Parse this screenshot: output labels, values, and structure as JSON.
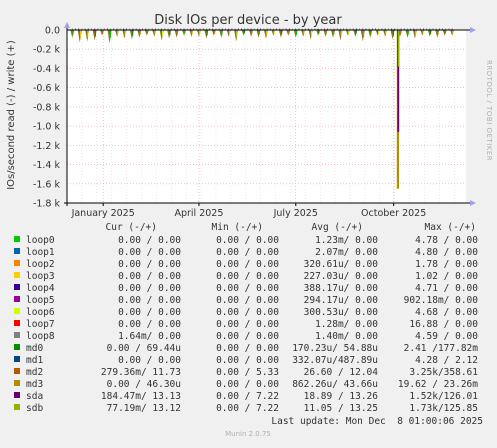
{
  "chart_data": {
    "type": "line",
    "title": "Disk IOs per device - by year",
    "ylabel": "IOs/second read (-) / write (+)",
    "side_label": "RRDTOOL / TOBI OETIKER",
    "ylim": [
      -1800,
      0
    ],
    "yticks": [
      {
        "v": 0,
        "label": "0.0"
      },
      {
        "v": -200,
        "label": "-0.2 k"
      },
      {
        "v": -400,
        "label": "-0.4 k"
      },
      {
        "v": -600,
        "label": "-0.6 k"
      },
      {
        "v": -800,
        "label": "-0.8 k"
      },
      {
        "v": -1000,
        "label": "-1.0 k"
      },
      {
        "v": -1200,
        "label": "-1.2 k"
      },
      {
        "v": -1400,
        "label": "-1.4 k"
      },
      {
        "v": -1600,
        "label": "-1.6 k"
      },
      {
        "v": -1800,
        "label": "-1.8 k"
      }
    ],
    "x_range": [
      "2024-11-28",
      "2025-12-08"
    ],
    "xticks": [
      {
        "date": "2025-01-01",
        "label": "January 2025"
      },
      {
        "date": "2025-04-01",
        "label": "April 2025"
      },
      {
        "date": "2025-07-01",
        "label": "July 2025"
      },
      {
        "date": "2025-10-01",
        "label": "October 2025"
      }
    ],
    "grid": true,
    "spike_start": "2024-12-03",
    "spike_period_days": 7,
    "spike_values": [
      -80,
      -130,
      -120,
      -110,
      -60,
      -140,
      -70,
      -90,
      -100,
      -80,
      -60,
      -70,
      -110,
      -90,
      -80,
      -60,
      -70,
      -70,
      -90,
      -60,
      -80,
      -70,
      -120,
      -60,
      -70,
      -80,
      -90,
      -60,
      -80,
      -60,
      -80,
      -70,
      -100,
      -60,
      -70,
      -80,
      -110,
      -60,
      -70,
      -120,
      -80,
      -60,
      -70,
      -100,
      -70,
      -80,
      -90,
      -60,
      -70,
      -80,
      -60,
      -60
    ],
    "big_spike": {
      "date": "2025-10-05",
      "values": [
        -1650,
        -1060,
        -380
      ]
    },
    "series": [
      {
        "name": "loop0",
        "color": "#00cc00"
      },
      {
        "name": "loop1",
        "color": "#0066b3"
      },
      {
        "name": "loop2",
        "color": "#ff8000"
      },
      {
        "name": "loop3",
        "color": "#ffcc00"
      },
      {
        "name": "loop4",
        "color": "#330099"
      },
      {
        "name": "loop5",
        "color": "#990099"
      },
      {
        "name": "loop6",
        "color": "#ccff00"
      },
      {
        "name": "loop7",
        "color": "#ff0000"
      },
      {
        "name": "loop8",
        "color": "#808080"
      },
      {
        "name": "md0",
        "color": "#008f00"
      },
      {
        "name": "md1",
        "color": "#00487d"
      },
      {
        "name": "md2",
        "color": "#b35a00"
      },
      {
        "name": "md3",
        "color": "#b38f00"
      },
      {
        "name": "sda",
        "color": "#6b006b"
      },
      {
        "name": "sdb",
        "color": "#8fb300"
      }
    ]
  },
  "legend": {
    "header": {
      "cur": "Cur (-/+)",
      "min": "Min (-/+)",
      "avg": "Avg (-/+)",
      "max": "Max (-/+)"
    },
    "rows": [
      {
        "name": "loop0",
        "color": "#00cc00",
        "cur": "0.00 /  0.00",
        "min": "0.00 /  0.00",
        "avg": "1.23m/  0.00",
        "max": "4.78 /  0.00"
      },
      {
        "name": "loop1",
        "color": "#0066b3",
        "cur": "0.00 /  0.00",
        "min": "0.00 /  0.00",
        "avg": "2.07m/  0.00",
        "max": "4.80 /  0.00"
      },
      {
        "name": "loop2",
        "color": "#ff8000",
        "cur": "0.00 /  0.00",
        "min": "0.00 /  0.00",
        "avg": "320.61u/  0.00",
        "max": "1.78 /  0.00"
      },
      {
        "name": "loop3",
        "color": "#ffcc00",
        "cur": "0.00 /  0.00",
        "min": "0.00 /  0.00",
        "avg": "227.03u/  0.00",
        "max": "1.02 /  0.00"
      },
      {
        "name": "loop4",
        "color": "#330099",
        "cur": "0.00 /  0.00",
        "min": "0.00 /  0.00",
        "avg": "388.17u/  0.00",
        "max": "4.71 /  0.00"
      },
      {
        "name": "loop5",
        "color": "#990099",
        "cur": "0.00 /  0.00",
        "min": "0.00 /  0.00",
        "avg": "294.17u/  0.00",
        "max": "902.18m/  0.00"
      },
      {
        "name": "loop6",
        "color": "#ccff00",
        "cur": "0.00 /  0.00",
        "min": "0.00 /  0.00",
        "avg": "300.53u/  0.00",
        "max": "4.68 /  0.00"
      },
      {
        "name": "loop7",
        "color": "#ff0000",
        "cur": "0.00 /  0.00",
        "min": "0.00 /  0.00",
        "avg": "1.28m/  0.00",
        "max": "16.88 /  0.00"
      },
      {
        "name": "loop8",
        "color": "#808080",
        "cur": "1.64m/  0.00",
        "min": "0.00 /  0.00",
        "avg": "1.40m/  0.00",
        "max": "4.59 /  0.00"
      },
      {
        "name": "md0",
        "color": "#008f00",
        "cur": "0.00 / 69.44u",
        "min": "0.00 /  0.00",
        "avg": "170.23u/ 54.88u",
        "max": "2.41 /177.82m"
      },
      {
        "name": "md1",
        "color": "#00487d",
        "cur": "0.00 /  0.00",
        "min": "0.00 /  0.00",
        "avg": "332.07u/487.89u",
        "max": "4.28 /  2.12"
      },
      {
        "name": "md2",
        "color": "#b35a00",
        "cur": "279.36m/ 11.73",
        "min": "0.00 /  5.33",
        "avg": "26.60 / 12.04",
        "max": "3.25k/358.61"
      },
      {
        "name": "md3",
        "color": "#b38f00",
        "cur": "0.00 / 46.30u",
        "min": "0.00 /  0.00",
        "avg": "862.26u/ 43.66u",
        "max": "19.62 / 23.26m"
      },
      {
        "name": "sda",
        "color": "#6b006b",
        "cur": "184.47m/ 13.13",
        "min": "0.00 /  7.22",
        "avg": "18.89 / 13.26",
        "max": "1.52k/126.01"
      },
      {
        "name": "sdb",
        "color": "#8fb300",
        "cur": "77.19m/ 13.12",
        "min": "0.00 /  7.22",
        "avg": "11.05 / 13.25",
        "max": "1.73k/125.85"
      }
    ]
  },
  "last_update": "Last update: Mon Dec  8 01:00:06 2025",
  "footer": "Munin 2.0.75"
}
